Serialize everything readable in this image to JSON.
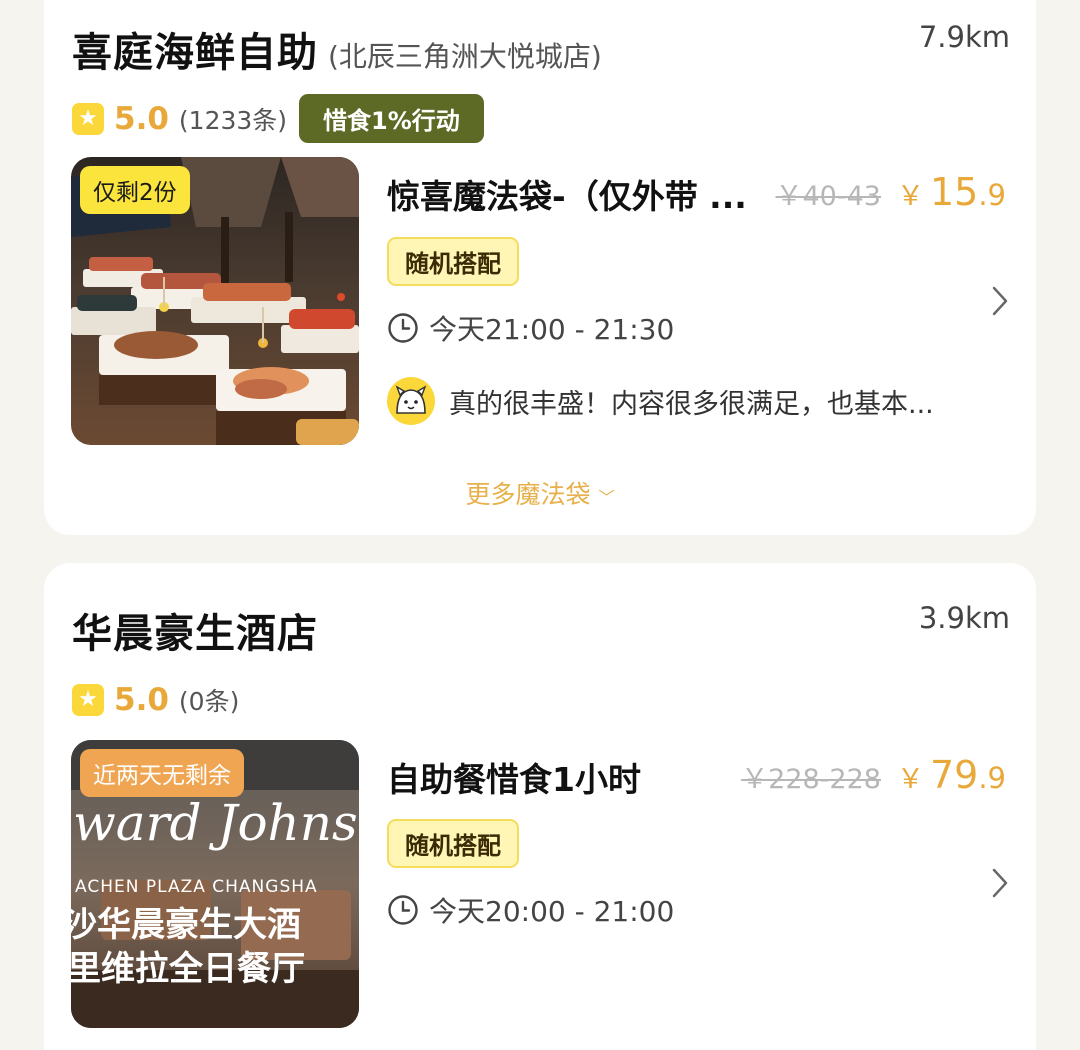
{
  "stores": [
    {
      "name": "喜庭海鲜自助",
      "branch": "(北辰三角洲大悦城店)",
      "distance": "7.9km",
      "star_icon": "star-icon",
      "rating": "5.0",
      "review_count": "(1233条)",
      "campaign_tag": "惜食1%行动",
      "stock_badge": "仅剩2份",
      "product_name": "惊喜魔法袋-（仅外带 ...",
      "original_price": "￥40-43",
      "price_symbol": "￥",
      "price_int": "15",
      "price_dec": ".9",
      "mix_tag": "随机搭配",
      "pickup_time": "今天21:00 - 21:30",
      "review_snippet": "真的很丰盛！内容很多很满足，也基本...",
      "more_link": "更多魔法袋",
      "colors": {
        "accent": "#e9a93a",
        "campaign": "#5d6a26",
        "stock_badge": "#fbe43b"
      }
    },
    {
      "name": "华晨豪生酒店",
      "distance": "3.9km",
      "star_icon": "star-icon",
      "rating": "5.0",
      "review_count": "(0条)",
      "stock_badge": "近两天无剩余",
      "product_name": "自助餐惜食1小时",
      "original_price": "￥228-228",
      "price_symbol": "￥",
      "price_int": "79",
      "price_dec": ".9",
      "mix_tag": "随机搭配",
      "pickup_time": "今天20:00 - 21:00",
      "image_text": {
        "line1": "ward Johnso",
        "line2": "ACHEN PLAZA CHANGSHA",
        "line3": "沙华晨豪生大酒",
        "line4": "里维拉全日餐厅"
      },
      "colors": {
        "accent": "#e9a93a",
        "stock_badge": "#efa552"
      }
    }
  ]
}
